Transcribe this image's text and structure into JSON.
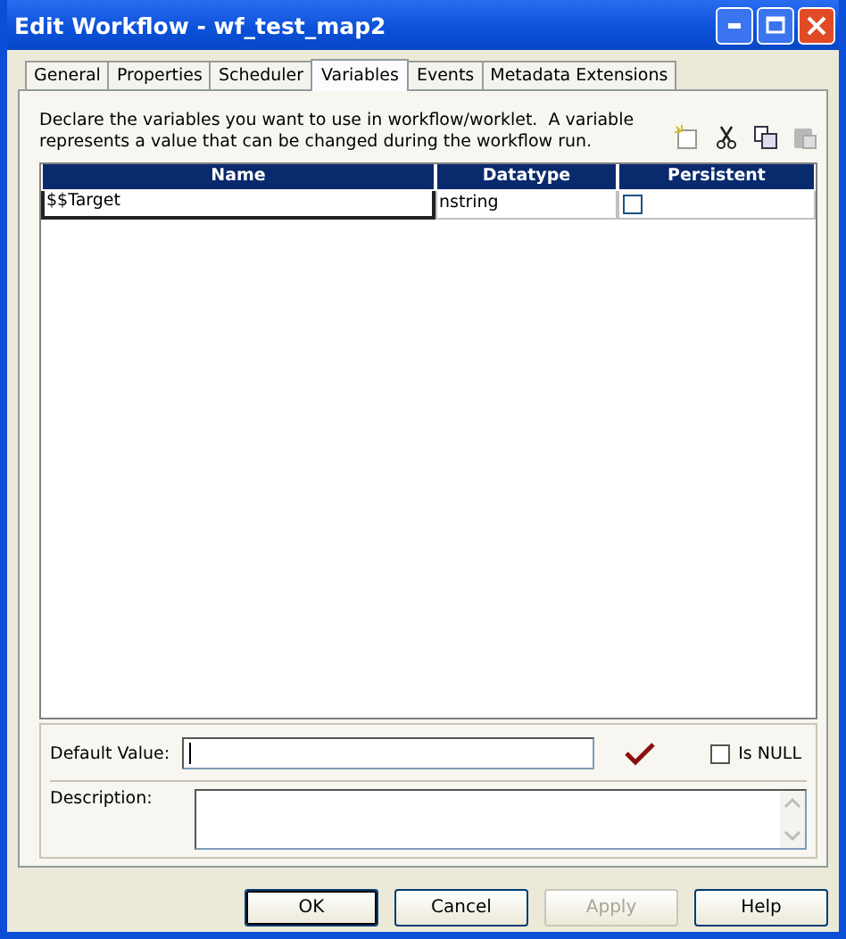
{
  "window": {
    "title": "Edit Workflow - wf_test_map2"
  },
  "tabs": [
    {
      "label": "General",
      "selected": false
    },
    {
      "label": "Properties",
      "selected": false
    },
    {
      "label": "Scheduler",
      "selected": false
    },
    {
      "label": "Variables",
      "selected": true
    },
    {
      "label": "Events",
      "selected": false
    },
    {
      "label": "Metadata Extensions",
      "selected": false
    }
  ],
  "instructions": "Declare the variables you want to use in workflow/worklet.  A variable represents a value that can be changed during the workflow run.",
  "table": {
    "columns": [
      "Name",
      "Datatype",
      "Persistent"
    ],
    "rows": [
      {
        "name": "$$Target",
        "datatype": "nstring",
        "persistent": false
      }
    ]
  },
  "default_value": {
    "label": "Default Value:",
    "is_null": {
      "label": "Is NULL",
      "checked": false
    }
  },
  "description_field": {
    "label": "Description:"
  },
  "buttons": [
    {
      "label": "OK",
      "disabled": false
    },
    {
      "label": "Cancel",
      "disabled": false
    },
    {
      "label": "Apply",
      "disabled": true
    },
    {
      "label": "Help",
      "disabled": false
    }
  ]
}
